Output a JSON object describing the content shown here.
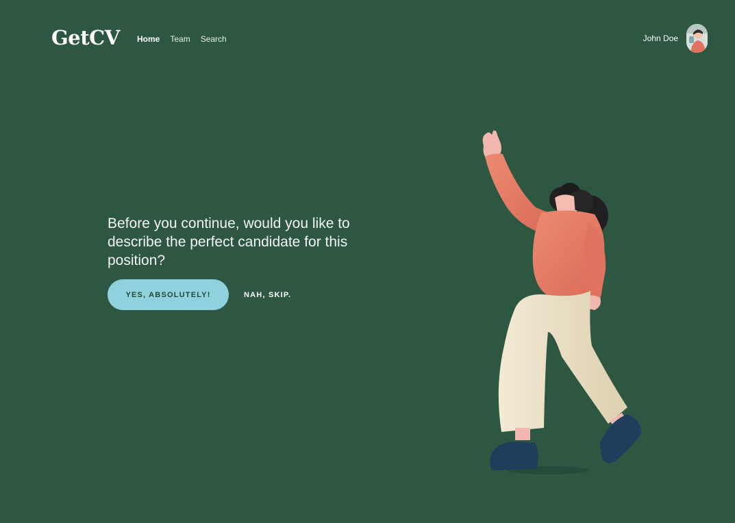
{
  "header": {
    "logo": "GetCV",
    "nav": [
      {
        "label": "Home",
        "active": true
      },
      {
        "label": "Team",
        "active": false
      },
      {
        "label": "Search",
        "active": false
      }
    ],
    "user_name": "John Doe",
    "avatar_icon": "user-avatar-icon"
  },
  "hero": {
    "question": "Before you continue, would you like to describe the perfect candidate for this position?",
    "primary_button": "YES, ABSOLUTELY!",
    "secondary_button": "NAH, SKIP."
  },
  "theme": {
    "background": "#2d5741",
    "primary_button_bg": "#8fd1dc",
    "primary_button_text": "#1f4a3a",
    "illustration_sweater": "#e47a65",
    "illustration_pants": "#efe3c8",
    "illustration_shoes": "#203d5c",
    "illustration_hair": "#1b1b1b"
  }
}
